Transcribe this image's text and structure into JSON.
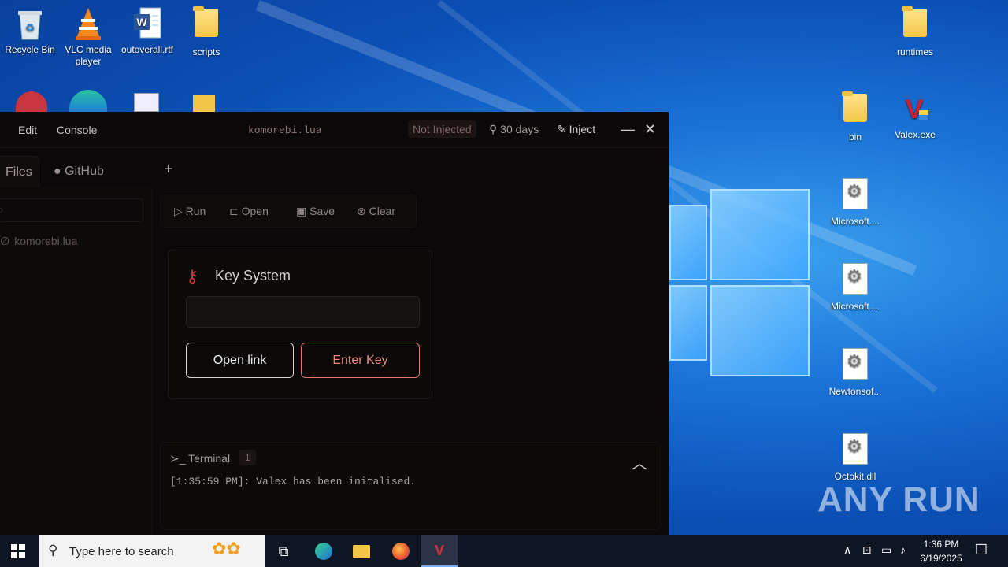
{
  "desktop": {
    "icons_left": [
      {
        "label": "Recycle Bin",
        "kind": "recycle"
      },
      {
        "label": "VLC media player",
        "kind": "vlc"
      },
      {
        "label": "outoverall.rtf",
        "kind": "word"
      },
      {
        "label": "scripts",
        "kind": "folder"
      }
    ],
    "icons_right": [
      {
        "label": "runtimes",
        "kind": "folder"
      },
      {
        "label": "bin",
        "kind": "folder"
      },
      {
        "label": "Valex.exe",
        "kind": "valex"
      },
      {
        "label": "Microsoft....",
        "kind": "dll"
      },
      {
        "label": "Microsoft....",
        "kind": "dll"
      },
      {
        "label": "Newtonsof...",
        "kind": "dll"
      },
      {
        "label": "Octokit.dll",
        "kind": "dll"
      }
    ],
    "watermark": "ANY RUN"
  },
  "app": {
    "menu": {
      "edit": "Edit",
      "console": "Console"
    },
    "title": "komorebi.lua",
    "status": "Not Injected",
    "license": "30 days",
    "inject": "Inject",
    "tabs": {
      "files": "Files",
      "github": "GitHub",
      "add": "+"
    },
    "sidebar": {
      "file": "komorebi.lua"
    },
    "toolbar": {
      "run": "Run",
      "open": "Open",
      "save": "Save",
      "clear": "Clear"
    },
    "key_system": {
      "title": "Key System",
      "input_value": "",
      "open_link": "Open link",
      "enter_key": "Enter Key"
    },
    "terminal": {
      "title": "Terminal",
      "count": "1",
      "line": "[1:35:59 PM]: Valex has been initalised."
    }
  },
  "taskbar": {
    "search_placeholder": "Type here to search",
    "time": "1:36 PM",
    "date": "6/19/2025"
  }
}
